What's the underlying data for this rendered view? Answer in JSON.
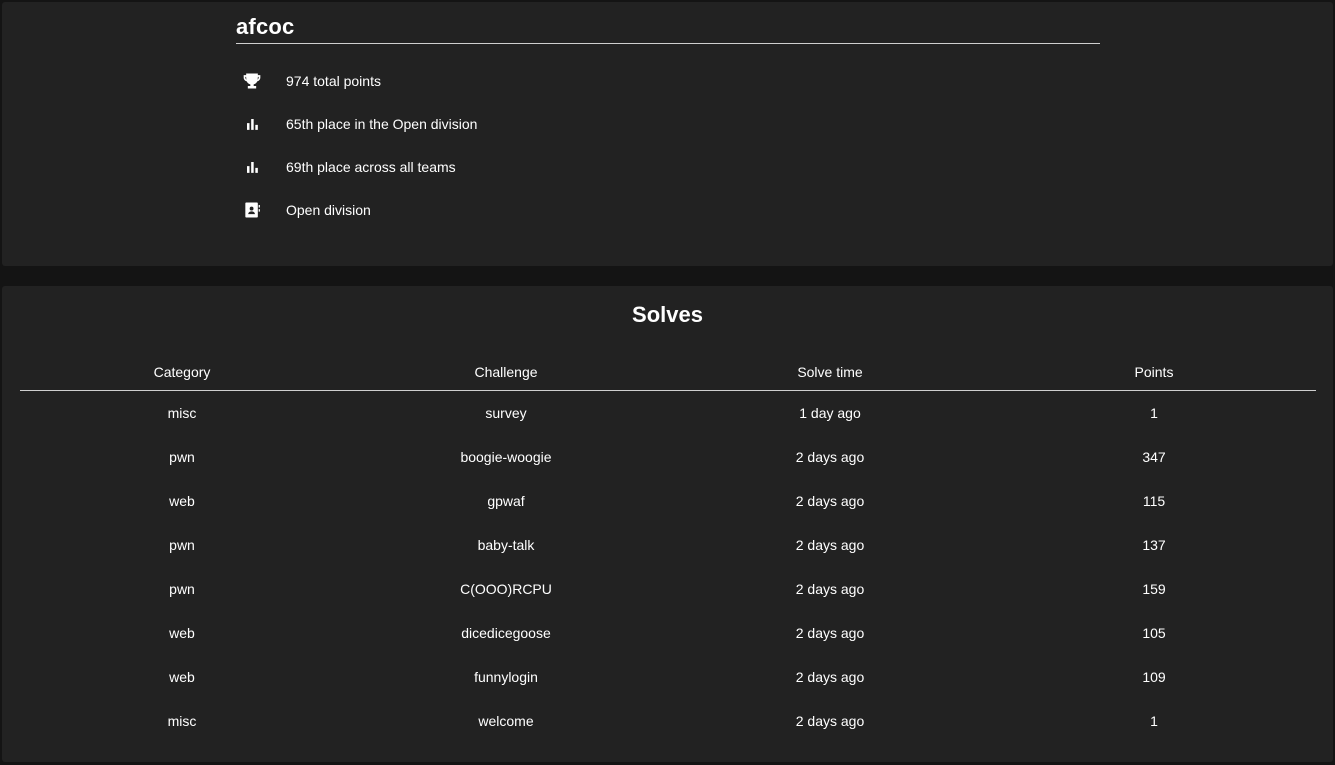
{
  "team": {
    "name": "afcoc"
  },
  "stats": {
    "total_points": "974 total points",
    "division_place": "65th place in the Open division",
    "overall_place": "69th place across all teams",
    "division": "Open division"
  },
  "icons": {
    "total_points": "trophy-icon",
    "division_place": "bar-chart-icon",
    "overall_place": "bar-chart-icon",
    "division": "contact-card-icon"
  },
  "colors": {
    "page_background": "#141414",
    "card_background": "#222222",
    "text": "#ffffff",
    "divider": "#cfcfcf"
  },
  "solves": {
    "title": "Solves",
    "columns": [
      "Category",
      "Challenge",
      "Solve time",
      "Points"
    ],
    "rows": [
      {
        "category": "misc",
        "challenge": "survey",
        "time": "1 day ago",
        "points": "1"
      },
      {
        "category": "pwn",
        "challenge": "boogie-woogie",
        "time": "2 days ago",
        "points": "347"
      },
      {
        "category": "web",
        "challenge": "gpwaf",
        "time": "2 days ago",
        "points": "115"
      },
      {
        "category": "pwn",
        "challenge": "baby-talk",
        "time": "2 days ago",
        "points": "137"
      },
      {
        "category": "pwn",
        "challenge": "C(OOO)RCPU",
        "time": "2 days ago",
        "points": "159"
      },
      {
        "category": "web",
        "challenge": "dicedicegoose",
        "time": "2 days ago",
        "points": "105"
      },
      {
        "category": "web",
        "challenge": "funnylogin",
        "time": "2 days ago",
        "points": "109"
      },
      {
        "category": "misc",
        "challenge": "welcome",
        "time": "2 days ago",
        "points": "1"
      }
    ]
  }
}
